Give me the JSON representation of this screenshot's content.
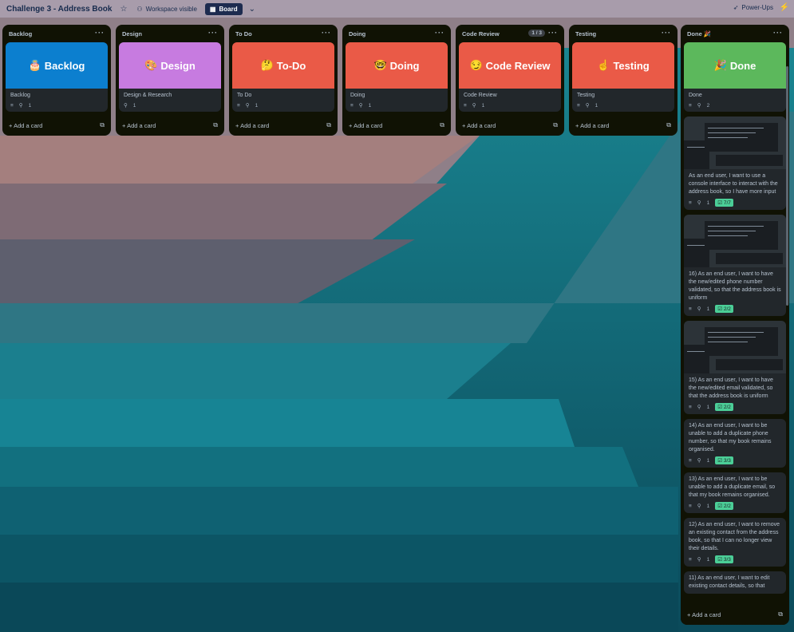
{
  "board": {
    "title": "Challenge 3 - Address Book",
    "visibility": "Workspace visible",
    "view": "Board",
    "power_ups": "Power-Ups"
  },
  "add_card_label": "Add a card",
  "lists": [
    {
      "name": "Backlog",
      "cover_text": "Backlog",
      "cover_emoji": "🎂",
      "cover_color": "#0c7fcf",
      "card_title": "Backlog",
      "has_description": true,
      "attachments": "1"
    },
    {
      "name": "Design",
      "cover_text": "Design",
      "cover_emoji": "🎨",
      "cover_color": "#c77be0",
      "card_title": "Design & Research",
      "has_description": false,
      "attachments": "1"
    },
    {
      "name": "To Do",
      "cover_text": "To-Do",
      "cover_emoji": "🤔",
      "cover_color": "#ea5a47",
      "card_title": "To Do",
      "has_description": true,
      "attachments": "1"
    },
    {
      "name": "Doing",
      "cover_text": "Doing",
      "cover_emoji": "🤓",
      "cover_color": "#ea5a47",
      "card_title": "Doing",
      "has_description": true,
      "attachments": "1"
    },
    {
      "name": "Code Review",
      "count": "1 / 3",
      "cover_text": "Code Review",
      "cover_emoji": "😏",
      "cover_color": "#ea5a47",
      "card_title": "Code Review",
      "has_description": true,
      "attachments": "1"
    },
    {
      "name": "Testing",
      "cover_text": "Testing",
      "cover_emoji": "☝️",
      "cover_color": "#ea5a47",
      "card_title": "Testing",
      "has_description": true,
      "attachments": "1"
    }
  ],
  "done": {
    "name": "Done 🎉",
    "cover_text": "Done",
    "cover_emoji": "🎉",
    "cover_color": "#5cb85c",
    "first_card_title": "Done",
    "first_card_attachments": "2",
    "cards": [
      {
        "title": "As an end user, I want to use a console interface to interact with the address book, so I have more input",
        "attachments": "1",
        "checklist": "7/7",
        "has_thumb": true
      },
      {
        "title": "16) As an end user, I want to have the new/edited phone number validated, so that the address book is uniform",
        "attachments": "1",
        "checklist": "2/2",
        "has_thumb": true
      },
      {
        "title": "15) As an end user, I want to have the new/edited email validated, so that the address book is uniform",
        "attachments": "1",
        "checklist": "2/2",
        "has_thumb": true
      },
      {
        "title": "14) As an end user, I want to be unable to add a duplicate phone number, so that my book remains organised.",
        "attachments": "1",
        "checklist": "3/3",
        "has_thumb": false
      },
      {
        "title": "13) As an end user, I want to be unable to add a duplicate email, so that my book remains organised.",
        "attachments": "1",
        "checklist": "2/2",
        "has_thumb": false
      },
      {
        "title": "12) As an end user, I want to remove an existing contact from the address book, so that I can no longer view their details.",
        "attachments": "1",
        "checklist": "3/3",
        "has_thumb": false
      },
      {
        "title": "11) As an end user, I want to edit existing contact details, so that",
        "attachments": "",
        "checklist": "",
        "has_thumb": false
      }
    ]
  }
}
